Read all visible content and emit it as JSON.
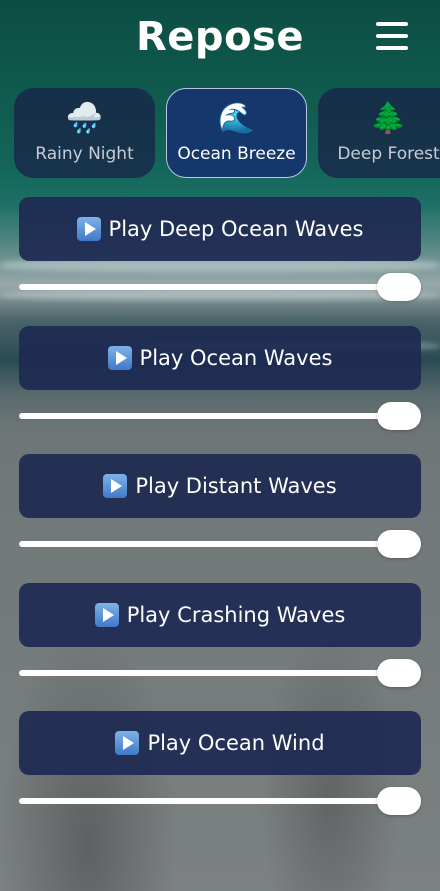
{
  "app": {
    "title": "Repose"
  },
  "header": {
    "menu_icon": "hamburger-menu-icon"
  },
  "presets": [
    {
      "icon": "🌧️",
      "icon_name": "rain-cloud-icon",
      "label": "Rainy Night",
      "active": false
    },
    {
      "icon": "🌊",
      "icon_name": "wave-icon",
      "label": "Ocean Breeze",
      "active": true
    },
    {
      "icon": "🌲",
      "icon_name": "evergreen-tree-icon",
      "label": "Deep Forest",
      "active": false
    }
  ],
  "tracks": [
    {
      "label": "Play Deep Ocean Waves",
      "icon_name": "play-icon",
      "volume": 1.0
    },
    {
      "label": "Play Ocean Waves",
      "icon_name": "play-icon",
      "volume": 1.0
    },
    {
      "label": "Play Distant Waves",
      "icon_name": "play-icon",
      "volume": 1.0
    },
    {
      "label": "Play Crashing Waves",
      "icon_name": "play-icon",
      "volume": 1.0
    },
    {
      "label": "Play Ocean Wind",
      "icon_name": "play-icon",
      "volume": 1.0
    }
  ],
  "colors": {
    "button_bg": "#1e2a52",
    "active_preset_bg": "#16346e",
    "text": "#ffffff"
  }
}
